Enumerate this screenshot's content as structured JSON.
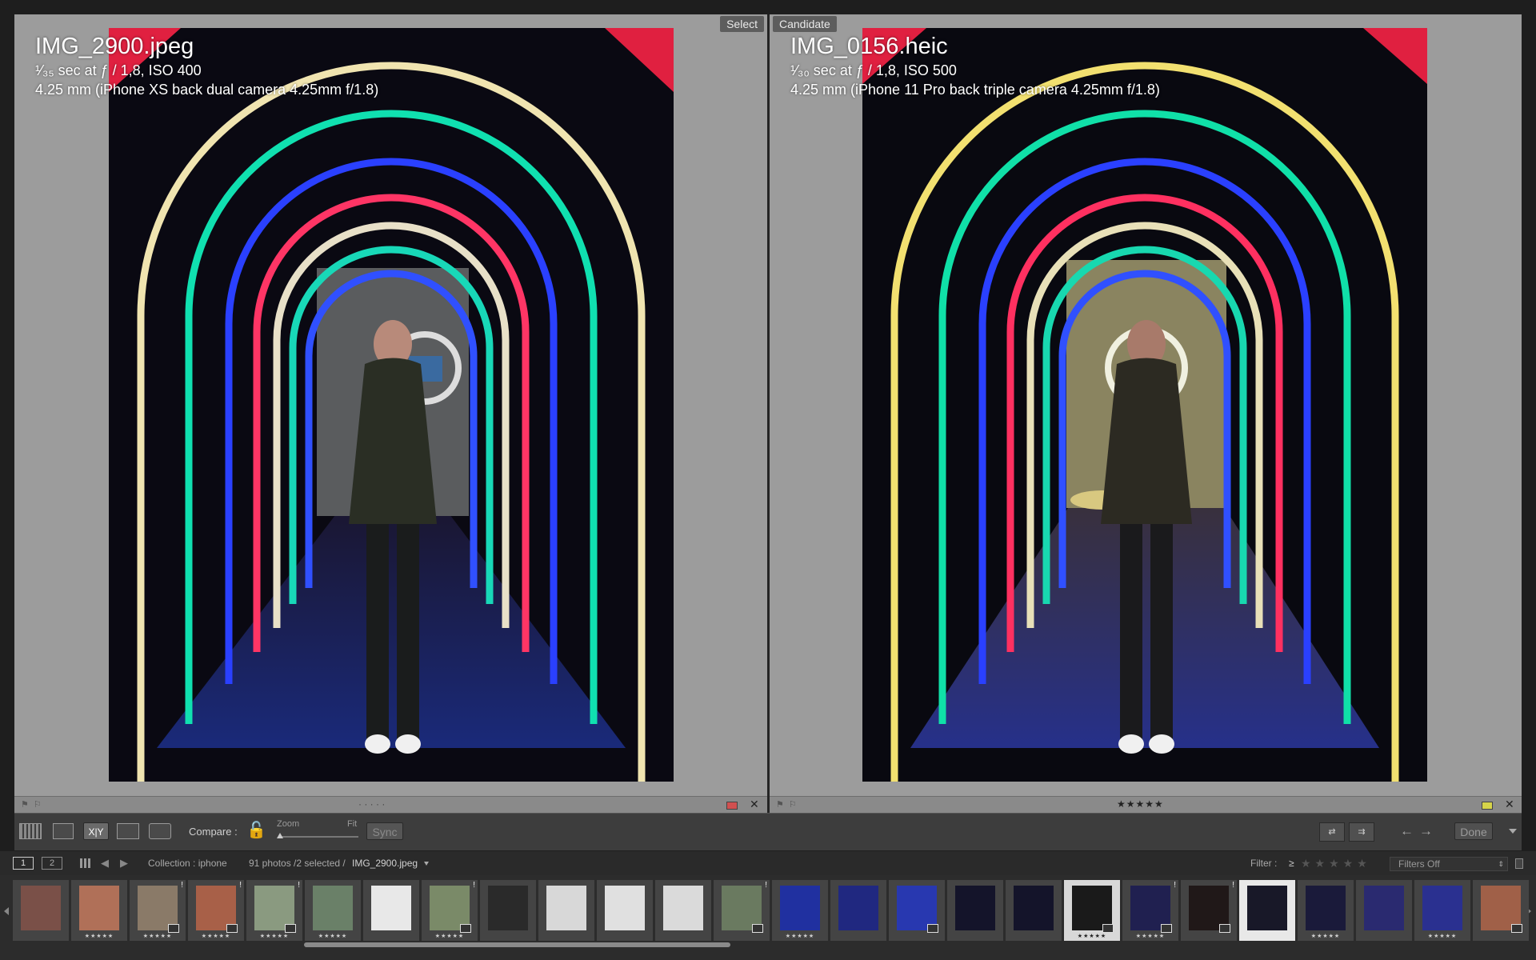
{
  "left": {
    "tag": "Select",
    "filename": "IMG_2900.jpeg",
    "exposure": "¹⁄₃₅ sec at ƒ / 1,8, ISO 400",
    "lens": "4.25 mm (iPhone XS back dual camera 4.25mm f/1.8)",
    "rating": "· · · · ·"
  },
  "right": {
    "tag": "Candidate",
    "filename": "IMG_0156.heic",
    "exposure": "¹⁄₃₀ sec at ƒ / 1,8, ISO 500",
    "lens": "4.25 mm (iPhone 11 Pro back triple camera 4.25mm f/1.8)",
    "rating": "★★★★★"
  },
  "toolbar": {
    "compare_label": "Compare :",
    "zoom_label": "Zoom",
    "fit_label": "Fit",
    "sync_label": "Sync",
    "xy_label": "X|Y",
    "done_label": "Done"
  },
  "filmstrip_header": {
    "page1": "1",
    "page2": "2",
    "collection": "Collection : iphone",
    "count": "91 photos /2 selected /",
    "current_file": "IMG_2900.jpeg",
    "filter_label": "Filter :",
    "filter_op": "≥",
    "filter_stars": "★★★★★",
    "filters_off": "Filters Off"
  },
  "colors": {
    "label_left": "#d05050",
    "label_right": "#d6d44a",
    "arch_colors": [
      "#f0e6a0",
      "#10e0b0",
      "#2040ff",
      "#ff3060",
      "#20d0c0",
      "#3050ff"
    ]
  },
  "thumbs": [
    {
      "bg": "#7a5048",
      "stars": "",
      "badge": false,
      "bang": false
    },
    {
      "bg": "#b07058",
      "stars": "★★★★★",
      "badge": false,
      "bang": false
    },
    {
      "bg": "#8a7a68",
      "stars": "★★★★★",
      "badge": true,
      "bang": true
    },
    {
      "bg": "#a86048",
      "stars": "★★★★★",
      "badge": true,
      "bang": true
    },
    {
      "bg": "#8a9a80",
      "stars": "★★★★★",
      "badge": true,
      "bang": true
    },
    {
      "bg": "#6a8068",
      "stars": "★★★★★",
      "badge": false,
      "bang": false
    },
    {
      "bg": "#e8e8e8",
      "stars": "",
      "badge": false,
      "bang": false
    },
    {
      "bg": "#7a8a68",
      "stars": "★★★★★",
      "badge": true,
      "bang": true
    },
    {
      "bg": "#2a2a2a",
      "stars": "",
      "badge": false,
      "bang": false
    },
    {
      "bg": "#d8d8d8",
      "stars": "",
      "badge": false,
      "bang": false
    },
    {
      "bg": "#e0e0e0",
      "stars": "",
      "badge": false,
      "bang": false
    },
    {
      "bg": "#dadada",
      "stars": "",
      "badge": false,
      "bang": false
    },
    {
      "bg": "#6a7a60",
      "stars": "",
      "badge": true,
      "bang": true
    },
    {
      "bg": "#2030a0",
      "stars": "★★★★★",
      "badge": false,
      "bang": false
    },
    {
      "bg": "#202880",
      "stars": "",
      "badge": false,
      "bang": false
    },
    {
      "bg": "#2838b0",
      "stars": "",
      "badge": true,
      "bang": false
    },
    {
      "bg": "#14142a",
      "stars": "",
      "badge": false,
      "bang": false
    },
    {
      "bg": "#14142a",
      "stars": "",
      "badge": false,
      "bang": false
    },
    {
      "bg": "#1a1a1a",
      "stars": "★★★★★",
      "badge": true,
      "bang": false
    },
    {
      "bg": "#202050",
      "stars": "★★★★★",
      "badge": true,
      "bang": true
    },
    {
      "bg": "#201818",
      "stars": "",
      "badge": true,
      "bang": true
    },
    {
      "bg": "#181828",
      "stars": "",
      "badge": false,
      "bang": false
    },
    {
      "bg": "#1a1a3a",
      "stars": "★★★★★",
      "badge": false,
      "bang": false
    },
    {
      "bg": "#2a2a70",
      "stars": "",
      "badge": false,
      "bang": false
    },
    {
      "bg": "#2a3090",
      "stars": "★★★★★",
      "badge": false,
      "bang": false
    },
    {
      "bg": "#a06048",
      "stars": "",
      "badge": true,
      "bang": false
    }
  ]
}
